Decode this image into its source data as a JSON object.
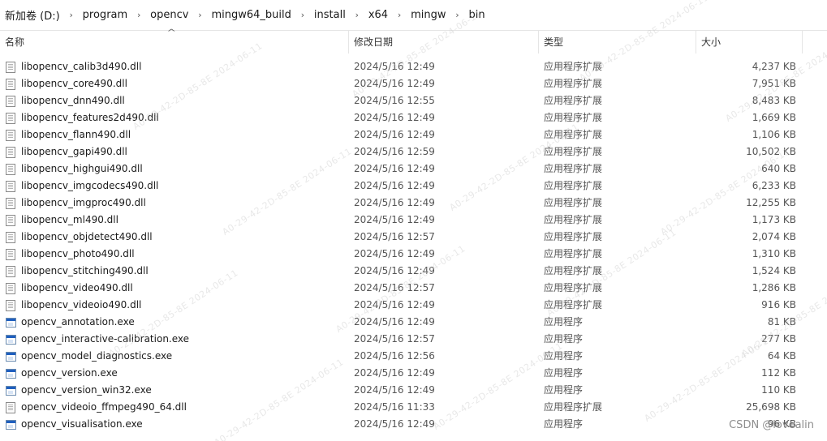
{
  "breadcrumb": [
    "新加卷 (D:)",
    "program",
    "opencv",
    "mingw64_build",
    "install",
    "x64",
    "mingw",
    "bin"
  ],
  "columns": {
    "name": "名称",
    "date": "修改日期",
    "type": "类型",
    "size": "大小"
  },
  "files": [
    {
      "name": "libopencv_calib3d490.dll",
      "date": "2024/5/16 12:49",
      "type": "应用程序扩展",
      "size": "4,237 KB",
      "icon": "dll-file-icon"
    },
    {
      "name": "libopencv_core490.dll",
      "date": "2024/5/16 12:49",
      "type": "应用程序扩展",
      "size": "7,951 KB",
      "icon": "dll-file-icon"
    },
    {
      "name": "libopencv_dnn490.dll",
      "date": "2024/5/16 12:55",
      "type": "应用程序扩展",
      "size": "8,483 KB",
      "icon": "dll-file-icon"
    },
    {
      "name": "libopencv_features2d490.dll",
      "date": "2024/5/16 12:49",
      "type": "应用程序扩展",
      "size": "1,669 KB",
      "icon": "dll-file-icon"
    },
    {
      "name": "libopencv_flann490.dll",
      "date": "2024/5/16 12:49",
      "type": "应用程序扩展",
      "size": "1,106 KB",
      "icon": "dll-file-icon"
    },
    {
      "name": "libopencv_gapi490.dll",
      "date": "2024/5/16 12:59",
      "type": "应用程序扩展",
      "size": "10,502 KB",
      "icon": "dll-file-icon"
    },
    {
      "name": "libopencv_highgui490.dll",
      "date": "2024/5/16 12:49",
      "type": "应用程序扩展",
      "size": "640 KB",
      "icon": "dll-file-icon"
    },
    {
      "name": "libopencv_imgcodecs490.dll",
      "date": "2024/5/16 12:49",
      "type": "应用程序扩展",
      "size": "6,233 KB",
      "icon": "dll-file-icon"
    },
    {
      "name": "libopencv_imgproc490.dll",
      "date": "2024/5/16 12:49",
      "type": "应用程序扩展",
      "size": "12,255 KB",
      "icon": "dll-file-icon"
    },
    {
      "name": "libopencv_ml490.dll",
      "date": "2024/5/16 12:49",
      "type": "应用程序扩展",
      "size": "1,173 KB",
      "icon": "dll-file-icon"
    },
    {
      "name": "libopencv_objdetect490.dll",
      "date": "2024/5/16 12:57",
      "type": "应用程序扩展",
      "size": "2,074 KB",
      "icon": "dll-file-icon"
    },
    {
      "name": "libopencv_photo490.dll",
      "date": "2024/5/16 12:49",
      "type": "应用程序扩展",
      "size": "1,310 KB",
      "icon": "dll-file-icon"
    },
    {
      "name": "libopencv_stitching490.dll",
      "date": "2024/5/16 12:49",
      "type": "应用程序扩展",
      "size": "1,524 KB",
      "icon": "dll-file-icon"
    },
    {
      "name": "libopencv_video490.dll",
      "date": "2024/5/16 12:57",
      "type": "应用程序扩展",
      "size": "1,286 KB",
      "icon": "dll-file-icon"
    },
    {
      "name": "libopencv_videoio490.dll",
      "date": "2024/5/16 12:49",
      "type": "应用程序扩展",
      "size": "916 KB",
      "icon": "dll-file-icon"
    },
    {
      "name": "opencv_annotation.exe",
      "date": "2024/5/16 12:49",
      "type": "应用程序",
      "size": "81 KB",
      "icon": "exe-file-icon"
    },
    {
      "name": "opencv_interactive-calibration.exe",
      "date": "2024/5/16 12:57",
      "type": "应用程序",
      "size": "277 KB",
      "icon": "exe-file-icon"
    },
    {
      "name": "opencv_model_diagnostics.exe",
      "date": "2024/5/16 12:56",
      "type": "应用程序",
      "size": "64 KB",
      "icon": "exe-file-icon"
    },
    {
      "name": "opencv_version.exe",
      "date": "2024/5/16 12:49",
      "type": "应用程序",
      "size": "112 KB",
      "icon": "exe-file-icon"
    },
    {
      "name": "opencv_version_win32.exe",
      "date": "2024/5/16 12:49",
      "type": "应用程序",
      "size": "110 KB",
      "icon": "exe-file-icon"
    },
    {
      "name": "opencv_videoio_ffmpeg490_64.dll",
      "date": "2024/5/16 11:33",
      "type": "应用程序扩展",
      "size": "25,698 KB",
      "icon": "dll-file-icon"
    },
    {
      "name": "opencv_visualisation.exe",
      "date": "2024/5/16 12:49",
      "type": "应用程序",
      "size": "96 KB",
      "icon": "exe-file-icon"
    }
  ],
  "watermark_text": "A0-29-42-2D-85-8E  2024-06-11",
  "csdn_credit": "CSDN @lovealin"
}
